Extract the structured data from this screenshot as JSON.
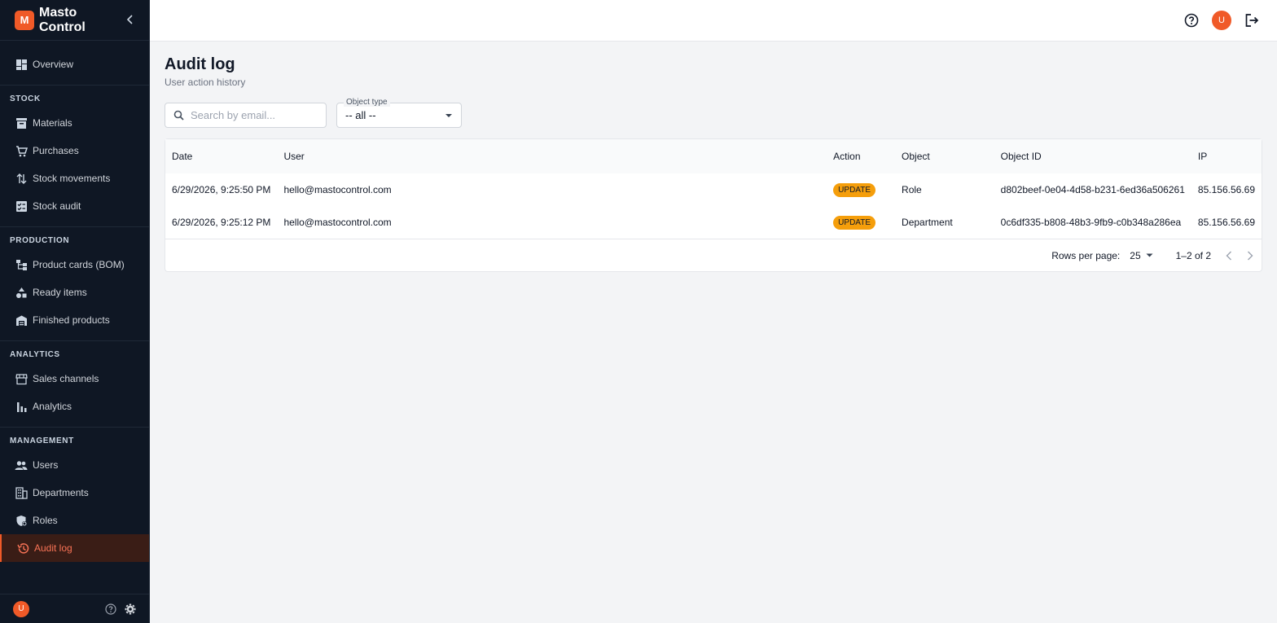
{
  "brand": {
    "logo_letter": "M",
    "name": "Masto Control",
    "accent": "#f05a28"
  },
  "sidebar": {
    "top": [
      {
        "label": "Overview",
        "icon": "dashboard-icon"
      }
    ],
    "sections": [
      {
        "title": "STOCK",
        "items": [
          {
            "label": "Materials",
            "icon": "archive-icon"
          },
          {
            "label": "Purchases",
            "icon": "cart-icon"
          },
          {
            "label": "Stock movements",
            "icon": "swap-vertical-icon"
          },
          {
            "label": "Stock audit",
            "icon": "checklist-icon"
          }
        ]
      },
      {
        "title": "PRODUCTION",
        "items": [
          {
            "label": "Product cards (BOM)",
            "icon": "tree-icon"
          },
          {
            "label": "Ready items",
            "icon": "shapes-icon"
          },
          {
            "label": "Finished products",
            "icon": "warehouse-icon"
          }
        ]
      },
      {
        "title": "ANALYTICS",
        "items": [
          {
            "label": "Sales channels",
            "icon": "store-icon"
          },
          {
            "label": "Analytics",
            "icon": "bar-chart-icon"
          }
        ]
      },
      {
        "title": "MANAGEMENT",
        "items": [
          {
            "label": "Users",
            "icon": "users-icon"
          },
          {
            "label": "Departments",
            "icon": "building-icon"
          },
          {
            "label": "Roles",
            "icon": "roles-icon"
          },
          {
            "label": "Audit log",
            "icon": "history-icon",
            "active": true
          }
        ]
      }
    ],
    "footer": {
      "avatar_letter": "U"
    }
  },
  "header": {
    "avatar_letter": "U"
  },
  "page": {
    "title": "Audit log",
    "subtitle": "User action history"
  },
  "filters": {
    "search_placeholder": "Search by email...",
    "object_type_label": "Object type",
    "object_type_value": "-- all --"
  },
  "table": {
    "columns": [
      "Date",
      "User",
      "Action",
      "Object",
      "Object ID",
      "IP"
    ],
    "rows": [
      {
        "date": "6/29/2026, 9:25:50 PM",
        "user": "hello@mastocontrol.com",
        "action": "UPDATE",
        "object": "Role",
        "object_id": "d802beef-0e04-4d58-b231-6ed36a506261",
        "ip": "85.156.56.69"
      },
      {
        "date": "6/29/2026, 9:25:12 PM",
        "user": "hello@mastocontrol.com",
        "action": "UPDATE",
        "object": "Department",
        "object_id": "0c6df335-b808-48b3-9fb9-c0b348a286ea",
        "ip": "85.156.56.69"
      }
    ]
  },
  "pagination": {
    "rows_per_page_label": "Rows per page:",
    "rows_per_page": "25",
    "range": "1–2 of 2"
  }
}
